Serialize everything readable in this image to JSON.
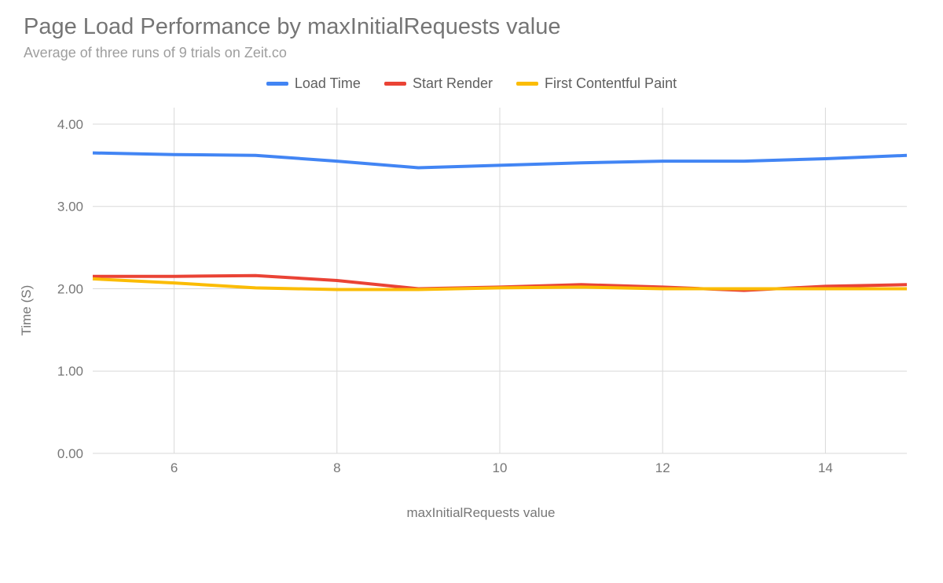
{
  "chart_data": {
    "type": "line",
    "title": "Page Load Performance by maxInitialRequests value",
    "subtitle": "Average of three runs of 9 trials on Zeit.co",
    "xlabel": "maxInitialRequests value",
    "ylabel": "Time (S)",
    "x": [
      5,
      6,
      7,
      8,
      9,
      10,
      11,
      12,
      13,
      14,
      15
    ],
    "x_ticks": [
      6,
      8,
      10,
      12,
      14
    ],
    "y_ticks": [
      0.0,
      1.0,
      2.0,
      3.0,
      4.0
    ],
    "ylim": [
      0,
      4.2
    ],
    "xlim": [
      5,
      15
    ],
    "series": [
      {
        "name": "Load Time",
        "color": "#4285f4",
        "values": [
          3.65,
          3.63,
          3.62,
          3.55,
          3.47,
          3.5,
          3.53,
          3.55,
          3.55,
          3.58,
          3.62
        ]
      },
      {
        "name": "Start Render",
        "color": "#ea4335",
        "values": [
          2.15,
          2.15,
          2.16,
          2.1,
          2.0,
          2.02,
          2.05,
          2.02,
          1.98,
          2.03,
          2.05
        ]
      },
      {
        "name": "First Contentful Paint",
        "color": "#fbbc04",
        "values": [
          2.12,
          2.07,
          2.01,
          1.99,
          1.99,
          2.01,
          2.02,
          2.0,
          2.0,
          2.0,
          2.0
        ]
      }
    ],
    "legend_position": "top"
  }
}
